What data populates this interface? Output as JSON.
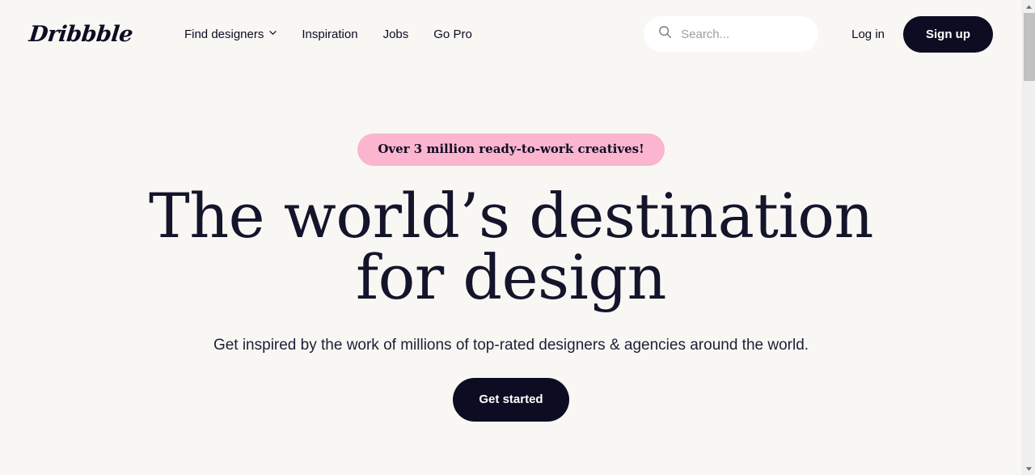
{
  "brand": {
    "logo_text": "Dribbble"
  },
  "header": {
    "nav": [
      {
        "label": "Find designers",
        "icon": "chevron-down-icon",
        "has_dropdown": true
      },
      {
        "label": "Inspiration",
        "has_dropdown": false
      },
      {
        "label": "Jobs",
        "has_dropdown": false
      },
      {
        "label": "Go Pro",
        "has_dropdown": false
      }
    ],
    "search": {
      "icon": "search-icon",
      "placeholder": "Search...",
      "value": ""
    },
    "login_label": "Log in",
    "signup_label": "Sign up"
  },
  "hero": {
    "badge": "Over 3 million ready-to-work creatives!",
    "headline_line1": "The world’s destination",
    "headline_line2": "for design",
    "subheadline": "Get inspired by the work of millions of top-rated designers & agencies around the world.",
    "cta_label": "Get started"
  },
  "scrollbar": {
    "up_arrow": "▲",
    "down_arrow": "▼"
  },
  "colors": {
    "background": "#f8f7f4",
    "ink": "#0d0c22",
    "headline": "#14142b",
    "badge_pink": "#fbb5cf",
    "search_field": "#ffffff",
    "placeholder": "#9e9ea7",
    "scrollbar_track": "#f0f0f0",
    "scrollbar_thumb": "#c1c1c1"
  }
}
